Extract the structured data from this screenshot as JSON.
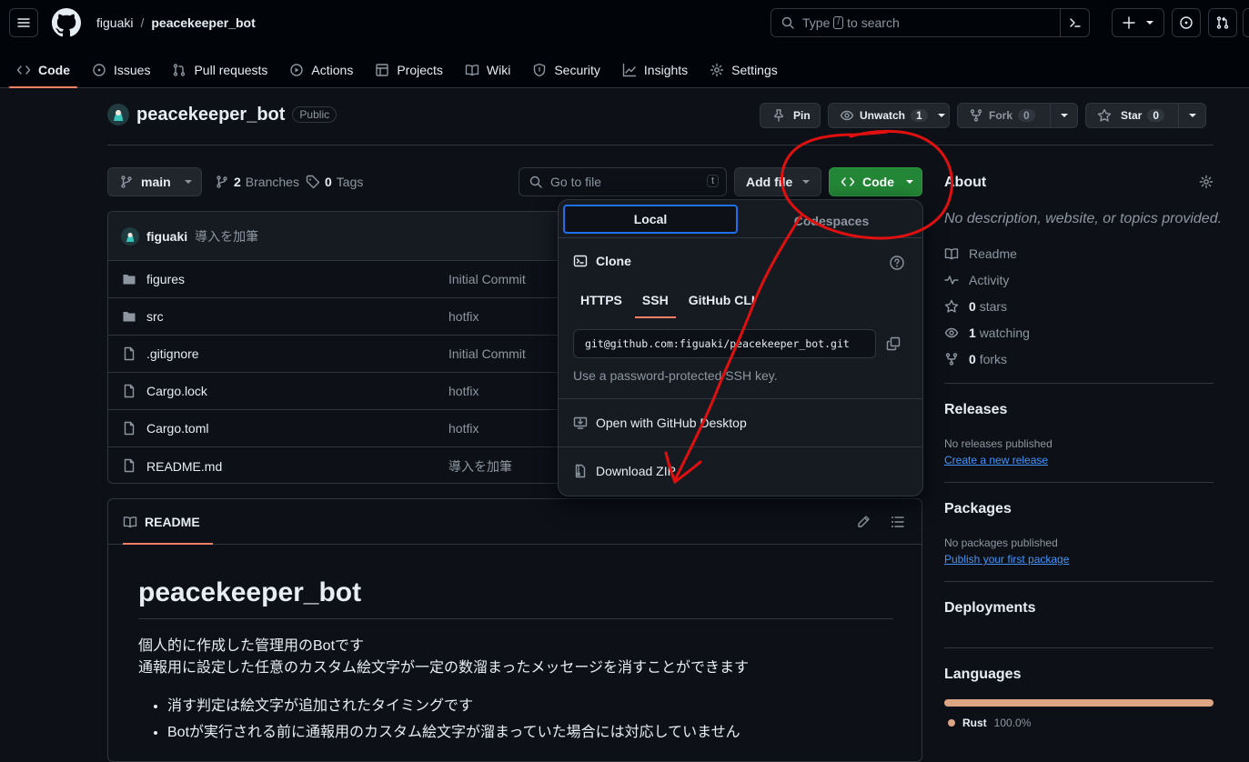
{
  "header": {
    "owner": "figuaki",
    "separator": "/",
    "repo": "peacekeeper_bot",
    "search_before": "Type",
    "search_key": "/",
    "search_after": "to search"
  },
  "tabs": [
    {
      "label": "Code",
      "icon": "code-icon"
    },
    {
      "label": "Issues",
      "icon": "issue-icon"
    },
    {
      "label": "Pull requests",
      "icon": "pull-request-icon"
    },
    {
      "label": "Actions",
      "icon": "play-icon"
    },
    {
      "label": "Projects",
      "icon": "table-icon"
    },
    {
      "label": "Wiki",
      "icon": "book-icon"
    },
    {
      "label": "Security",
      "icon": "shield-icon"
    },
    {
      "label": "Insights",
      "icon": "graph-icon"
    },
    {
      "label": "Settings",
      "icon": "gear-icon"
    }
  ],
  "repo": {
    "name": "peacekeeper_bot",
    "visibility": "Public",
    "pin": "Pin",
    "unwatch": "Unwatch",
    "watch_count": "1",
    "fork": "Fork",
    "fork_count": "0",
    "star": "Star",
    "star_count": "0"
  },
  "toolbar": {
    "branch": "main",
    "branches_count": "2",
    "branches_label": "Branches",
    "tags_count": "0",
    "tags_label": "Tags",
    "goto_placeholder": "Go to file",
    "goto_key": "t",
    "add_file": "Add file",
    "code": "Code"
  },
  "commit": {
    "author": "figuaki",
    "message": "導入を加筆"
  },
  "files": [
    {
      "name": "figures",
      "type": "folder",
      "message": "Initial Commit"
    },
    {
      "name": "src",
      "type": "folder",
      "message": "hotfix"
    },
    {
      "name": ".gitignore",
      "type": "file",
      "message": "Initial Commit"
    },
    {
      "name": "Cargo.lock",
      "type": "file",
      "message": "hotfix"
    },
    {
      "name": "Cargo.toml",
      "type": "file",
      "message": "hotfix"
    },
    {
      "name": "README.md",
      "type": "file",
      "message": "導入を加筆"
    }
  ],
  "readme": {
    "tab": "README",
    "title": "peacekeeper_bot",
    "line1": "個人的に作成した管理用のBotです",
    "line2": "通報用に設定した任意のカスタム絵文字が一定の数溜まったメッセージを消すことができます",
    "bullets": [
      "消す判定は絵文字が追加されたタイミングです",
      "Botが実行される前に通報用のカスタム絵文字が溜まっていた場合には対応していません"
    ]
  },
  "about": {
    "title": "About",
    "description": "No description, website, or topics provided.",
    "readme": "Readme",
    "activity": "Activity",
    "stars_count": "0",
    "stars_label": "stars",
    "watching_count": "1",
    "watching_label": "watching",
    "forks_count": "0",
    "forks_label": "forks"
  },
  "releases": {
    "title": "Releases",
    "empty": "No releases published",
    "link": "Create a new release"
  },
  "packages": {
    "title": "Packages",
    "empty": "No packages published",
    "link": "Publish your first package"
  },
  "deployments": {
    "title": "Deployments"
  },
  "languages": {
    "title": "Languages",
    "items": [
      {
        "name": "Rust",
        "percent": "100.0%",
        "color": "#dea584",
        "share": 1.0
      }
    ]
  },
  "clone_dropdown": {
    "tab_local": "Local",
    "tab_codespaces": "Codespaces",
    "clone_label": "Clone",
    "protocols": [
      "HTTPS",
      "SSH",
      "GitHub CLI"
    ],
    "active_protocol": "SSH",
    "url": "git@github.com:figuaki/peacekeeper_bot.git",
    "hint": "Use a password-protected SSH key.",
    "open_desktop": "Open with GitHub Desktop",
    "download_zip": "Download ZIP"
  },
  "colors": {
    "accent_underline": "#f78166",
    "primary_button": "#238636",
    "annotation": "#e01010",
    "link": "#4493f8"
  }
}
